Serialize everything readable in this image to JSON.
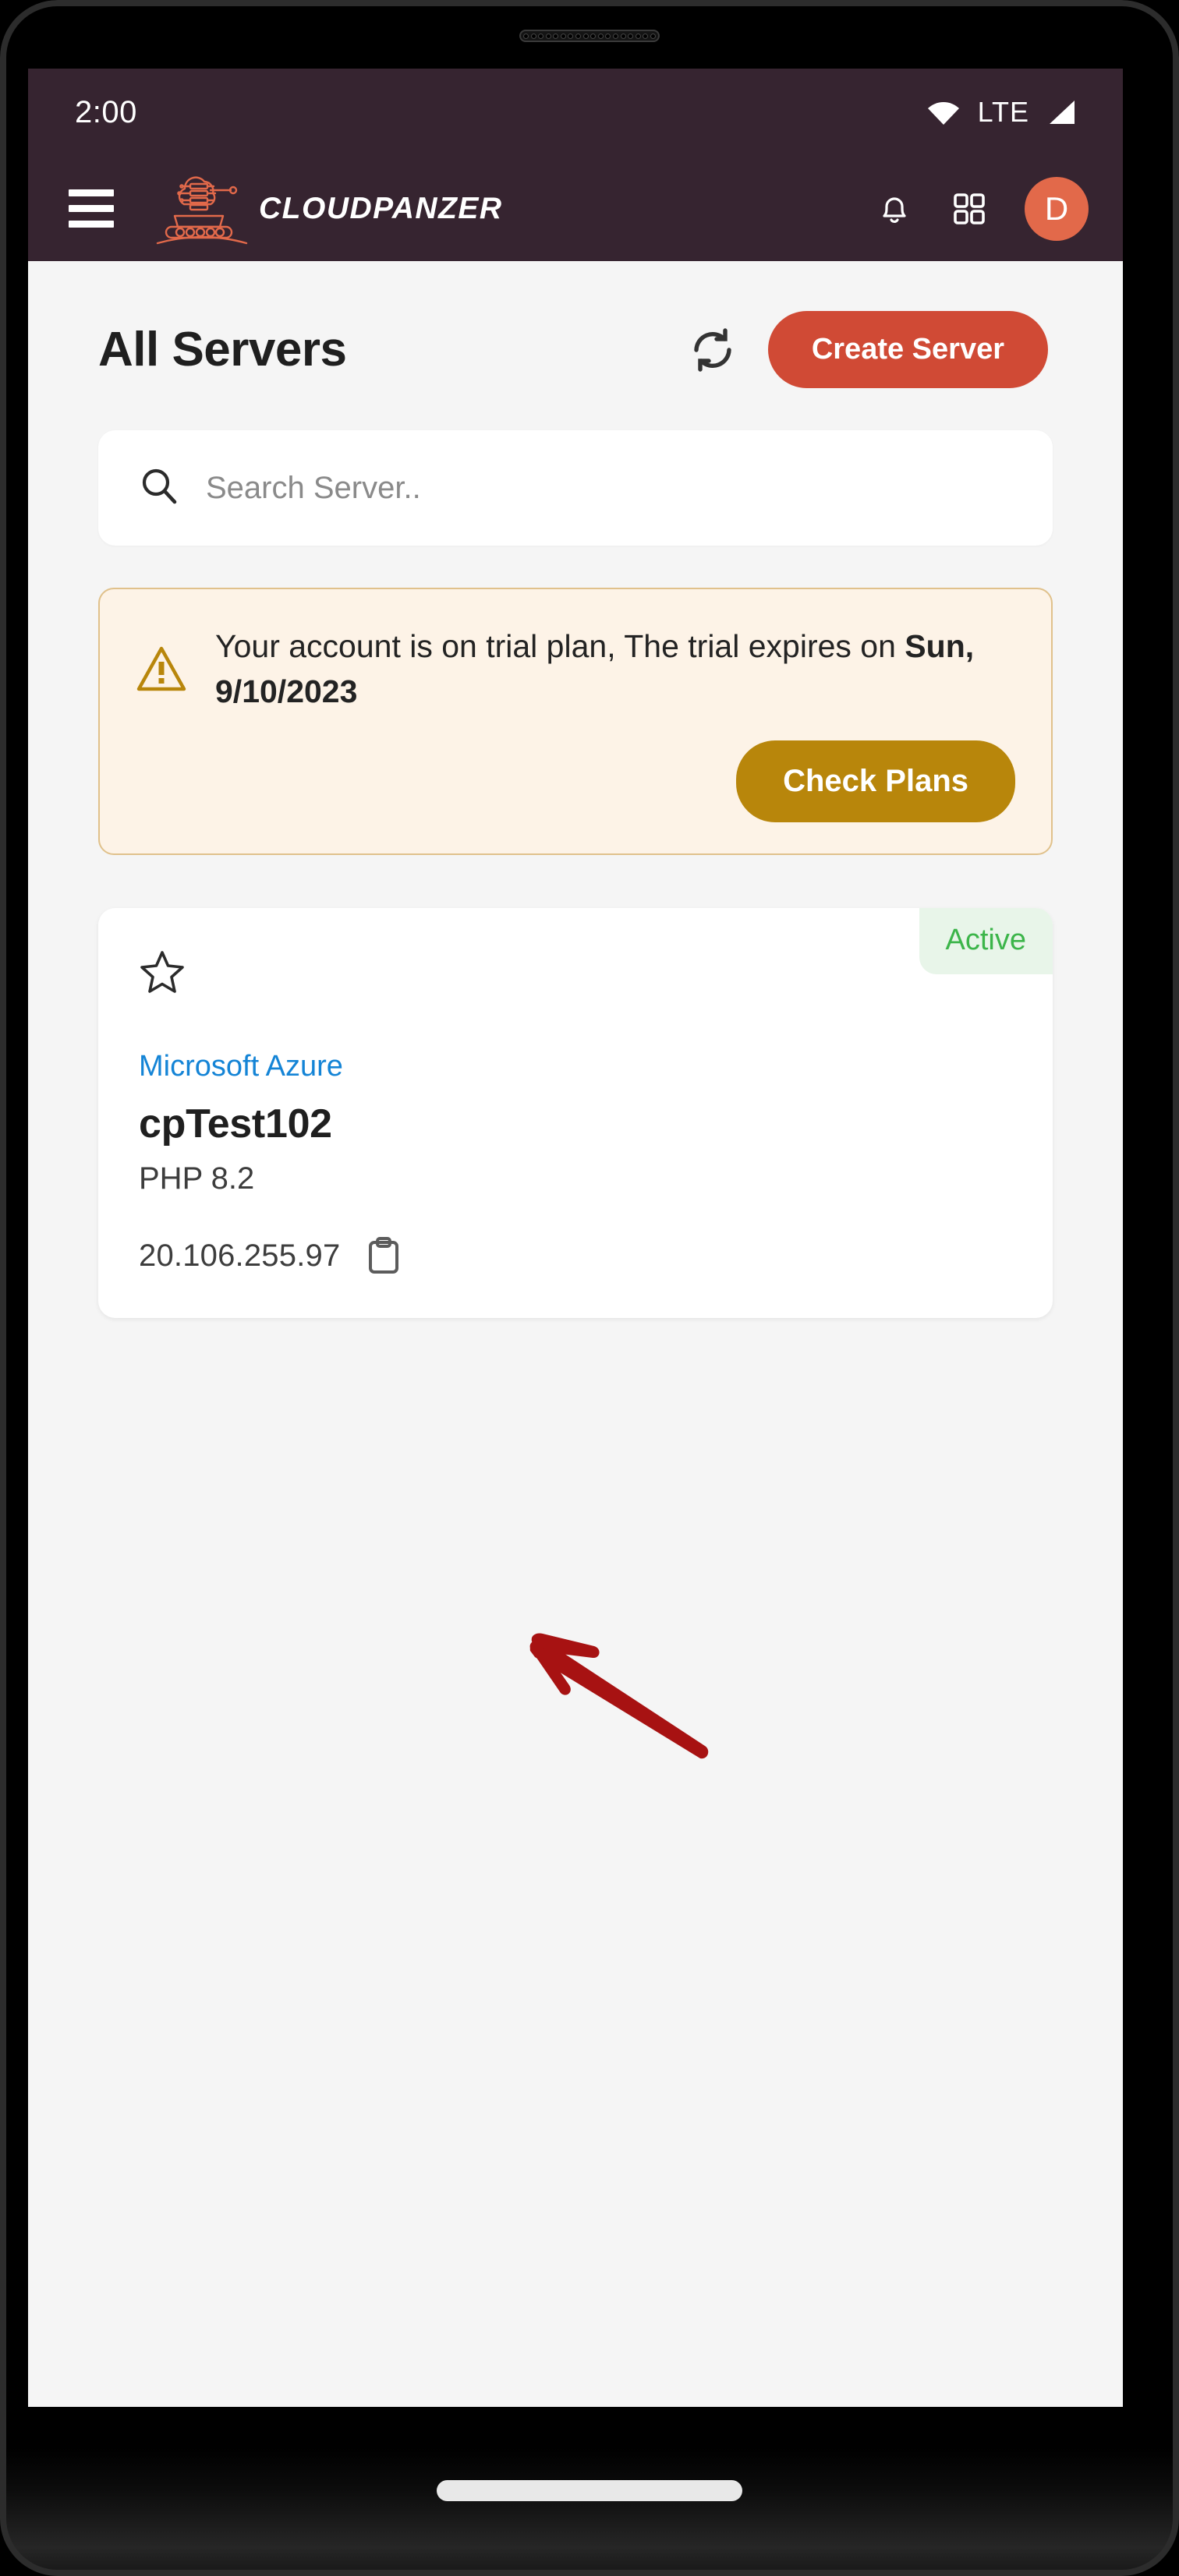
{
  "device": {
    "earpiece_dots": 18
  },
  "status_bar": {
    "clock": "2:00",
    "network_label": "LTE",
    "wifi_icon": "wifi-icon",
    "signal_icon": "cellular-signal-icon"
  },
  "header": {
    "menu_icon": "hamburger-menu-icon",
    "brand_name": "CLOUDPANZER",
    "brand_logo_icon": "cloud-tank-logo-icon",
    "notification_icon": "bell-icon",
    "apps_icon": "grid-apps-icon",
    "avatar_initial": "D"
  },
  "page": {
    "title": "All Servers",
    "refresh_icon": "refresh-icon",
    "create_button_label": "Create Server"
  },
  "search": {
    "icon": "search-icon",
    "placeholder": "Search Server..",
    "value": ""
  },
  "trial_banner": {
    "icon": "warning-triangle-icon",
    "message_prefix": "Your account is on trial plan, The trial expires on ",
    "expiry_date": "Sun, 9/10/2023",
    "cta_label": "Check Plans"
  },
  "servers": [
    {
      "status": "Active",
      "favorite_icon": "star-outline-icon",
      "provider": "Microsoft Azure",
      "name": "cpTest102",
      "php_version": "PHP 8.2",
      "ip_address": "20.106.255.97",
      "copy_icon": "clipboard-copy-icon"
    }
  ],
  "annotation": {
    "arrow_icon": "red-arrow-annotation"
  },
  "colors": {
    "header_bg": "#362430",
    "accent_red": "#d04a35",
    "accent_orange": "#e2694a",
    "trial_gold": "#b8860b",
    "trial_bg": "#fdf3e7",
    "trial_border": "#e0c18b",
    "link_blue": "#1484d6",
    "status_green": "#3cb54a",
    "status_green_bg": "#e8f5e9",
    "screen_bg": "#f5f5f5",
    "annotation_red": "#a71212"
  }
}
